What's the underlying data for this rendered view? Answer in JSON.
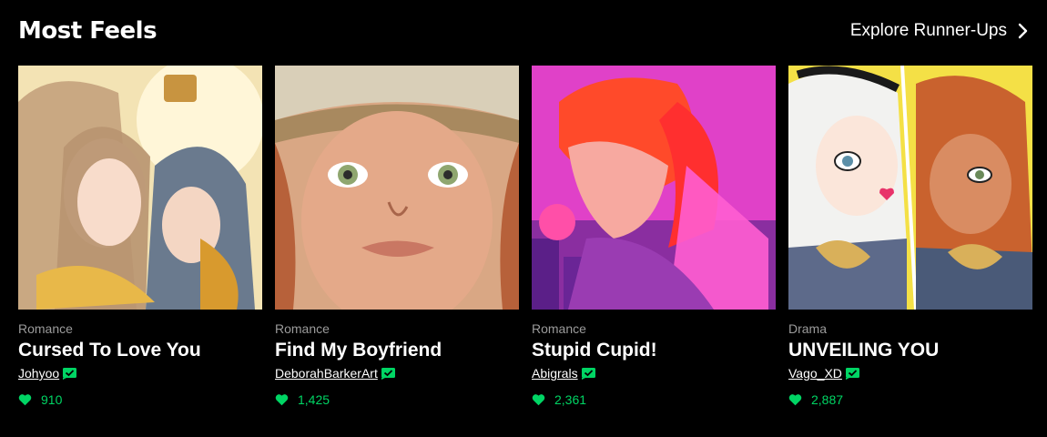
{
  "section": {
    "title": "Most Feels",
    "explore_label": "Explore Runner-Ups"
  },
  "colors": {
    "background": "#000000",
    "likes_green": "#00d564",
    "genre_gray": "#9b9b9b"
  },
  "cards": [
    {
      "genre": "Romance",
      "title": "Cursed To Love You",
      "author": "Johyoo",
      "likes": "910"
    },
    {
      "genre": "Romance",
      "title": "Find My Boyfriend",
      "author": "DeborahBarkerArt",
      "likes": "1,425"
    },
    {
      "genre": "Romance",
      "title": "Stupid Cupid!",
      "author": "Abigrals",
      "likes": "2,361"
    },
    {
      "genre": "Drama",
      "title": "UNVEILING YOU",
      "author": "Vago_XD",
      "likes": "2,887"
    }
  ]
}
